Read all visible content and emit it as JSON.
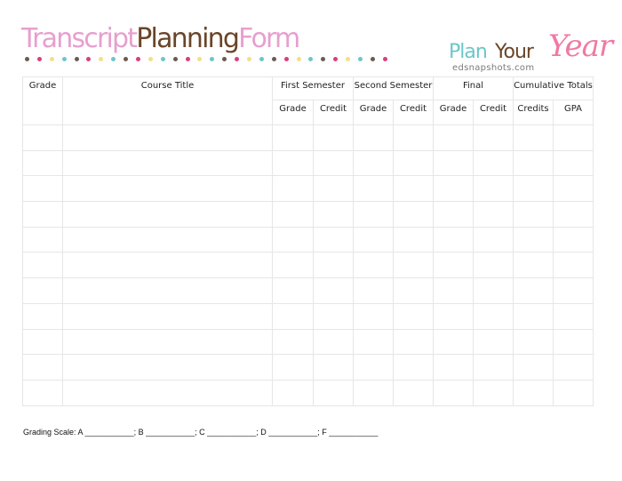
{
  "title": {
    "part1": "Transcript",
    "part2": "Planning",
    "part3": "Form"
  },
  "colors": {
    "pink": "#e6a0cf",
    "brown": "#6a4528",
    "teal": "#6cc6c9",
    "yellow": "#f1e08a",
    "dot_pink": "#d83f7c",
    "dot_brown": "#6b5a50"
  },
  "logo": {
    "plan": "Plan",
    "your": "Your",
    "year": "Year",
    "site": "edsnapshots.com"
  },
  "table": {
    "headers": {
      "grade": "Grade",
      "course_title": "Course Title",
      "groups": [
        "First Semester",
        "Second Semester",
        "Final",
        "Cumulative Totals"
      ],
      "sub": [
        "Grade",
        "Credit",
        "Grade",
        "Credit",
        "Grade",
        "Credit",
        "Credits",
        "GPA"
      ]
    },
    "row_count": 11
  },
  "grading_scale": {
    "label": "Grading Scale:",
    "text": "Grading Scale: A ___________; B ___________; C ___________; D ___________; F ___________"
  }
}
